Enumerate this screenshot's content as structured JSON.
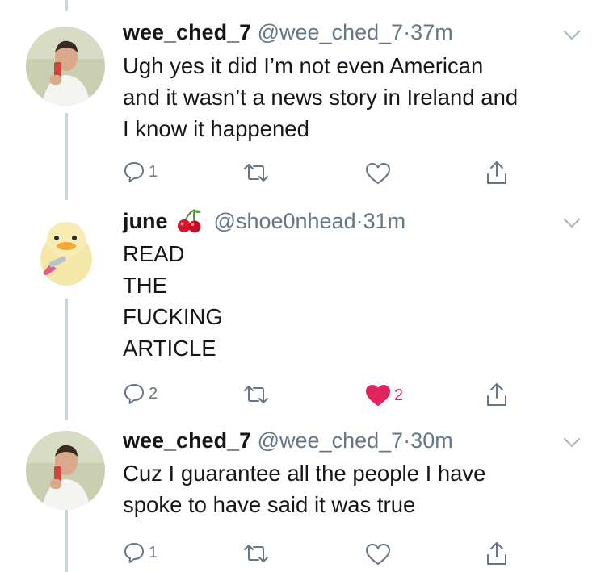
{
  "colors": {
    "thread_line": "#ccd6dd",
    "muted": "#657786",
    "liked": "#e0245e"
  },
  "tweets": [
    {
      "name": "wee_ched_7",
      "handle": "@wee_ched_7",
      "dot": "·",
      "time": "37m",
      "lines": [
        "Ugh yes it did I’m not even American",
        "and it wasn’t a news story in Ireland and",
        "I know it happened"
      ],
      "reply_count": "1",
      "retweet_count": "",
      "like_count": "",
      "liked": false
    },
    {
      "name": "june",
      "emoji": "cherries",
      "handle": "@shoe0nhead",
      "dot": "·",
      "time": "31m",
      "lines": [
        "READ",
        "THE",
        "FUCKING",
        "ARTICLE"
      ],
      "reply_count": "2",
      "retweet_count": "",
      "like_count": "2",
      "liked": true
    },
    {
      "name": "wee_ched_7",
      "handle": "@wee_ched_7",
      "dot": "·",
      "time": "30m",
      "lines": [
        "Cuz I guarantee all the people I have",
        "spoke to have said it was true"
      ],
      "reply_count": "1",
      "retweet_count": "",
      "like_count": "",
      "liked": false
    }
  ]
}
